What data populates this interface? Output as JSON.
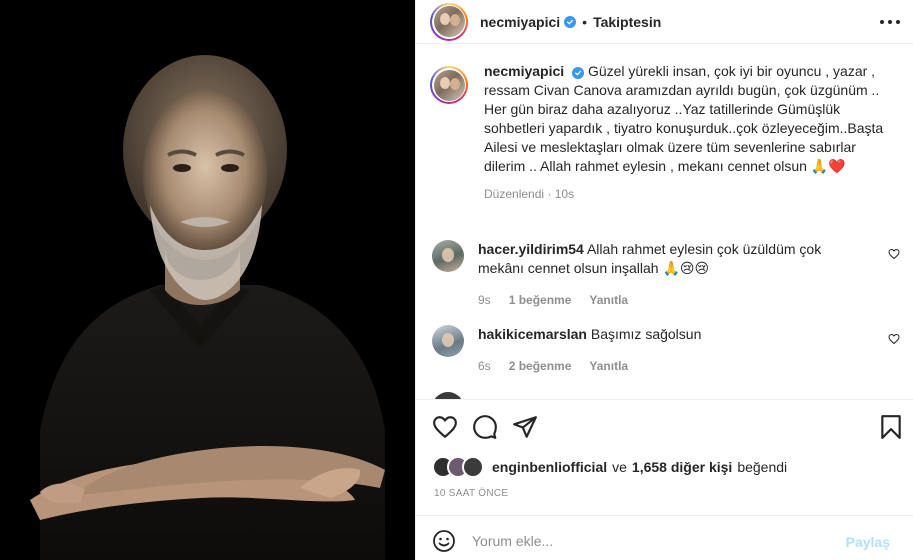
{
  "post": {
    "author": "necmiyapici",
    "verified": true,
    "follow_status": "Takiptesin",
    "separator": "•"
  },
  "caption": {
    "user": "necmiyapici",
    "text": "Güzel yürekli insan, çok iyi bir oyuncu , yazar , ressam Civan Canova aramızdan ayrıldı bugün, çok üzgünüm .. Her gün biraz daha azalıyoruz ..Yaz tatillerinde Gümüşlük sohbetleri yapardık , tiyatro konuşurduk..çok özleyeceğim..Başta Ailesi ve meslektaşları olmak üzere tüm sevenlerine sabırlar dilerim .. Allah rahmet eylesin , mekanı cennet olsun 🙏❤️",
    "edited_label": "Düzenlendi",
    "time": "10s",
    "meta_sep": "·"
  },
  "comments": [
    {
      "user": "hacer.yildirim54",
      "text": "Allah rahmet eylesin çok üzüldüm çok mekânı cennet olsun inşallah 🙏😢😢",
      "time": "9s",
      "likes": "1 beğenme",
      "reply": "Yanıtla"
    },
    {
      "user": "hakikicemarslan",
      "text": "Başımız sağolsun",
      "time": "6s",
      "likes": "2 beğenme",
      "reply": "Yanıtla"
    }
  ],
  "likes": {
    "first_user": "enginbenliofficial",
    "connector": "ve",
    "others": "1,658 diğer kişi",
    "suffix": "beğendi"
  },
  "timestamp": "10 SAAT ÖNCE",
  "add_comment": {
    "placeholder": "Yorum ekle...",
    "share_label": "Paylaş",
    "share_color": "#b2dffc"
  },
  "icons": {
    "verified": "verified-badge-icon",
    "more": "more-options-icon",
    "like": "heart-icon",
    "comment": "comment-bubble-icon",
    "share": "paper-plane-icon",
    "save": "bookmark-icon",
    "emoji": "smiley-icon"
  },
  "colors": {
    "verified_blue": "#3897f0",
    "muted_text": "#8e8e8e",
    "divider": "#efefef"
  }
}
